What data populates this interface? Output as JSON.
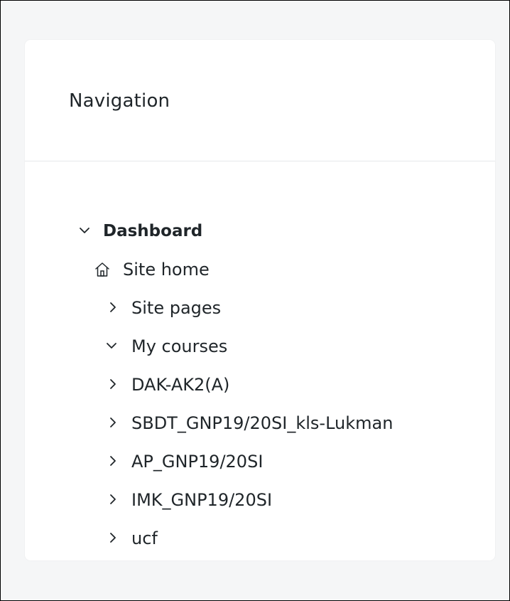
{
  "navigation": {
    "title": "Navigation",
    "items": [
      {
        "label": "Dashboard",
        "expanded": true,
        "bold": true,
        "icon": "chevron-down-icon"
      },
      {
        "label": "Site home",
        "icon": "home-icon"
      },
      {
        "label": "Site pages",
        "expanded": false,
        "icon": "chevron-right-icon"
      },
      {
        "label": "My courses",
        "expanded": true,
        "icon": "chevron-down-icon"
      },
      {
        "label": "DAK-AK2(A)",
        "expanded": false,
        "icon": "chevron-right-icon"
      },
      {
        "label": "SBDT_GNP19/20SI_kls-Lukman",
        "expanded": false,
        "icon": "chevron-right-icon"
      },
      {
        "label": "AP_GNP19/20SI",
        "expanded": false,
        "icon": "chevron-right-icon"
      },
      {
        "label": "IMK_GNP19/20SI",
        "expanded": false,
        "icon": "chevron-right-icon"
      },
      {
        "label": "ucf",
        "expanded": false,
        "icon": "chevron-right-icon"
      }
    ]
  }
}
